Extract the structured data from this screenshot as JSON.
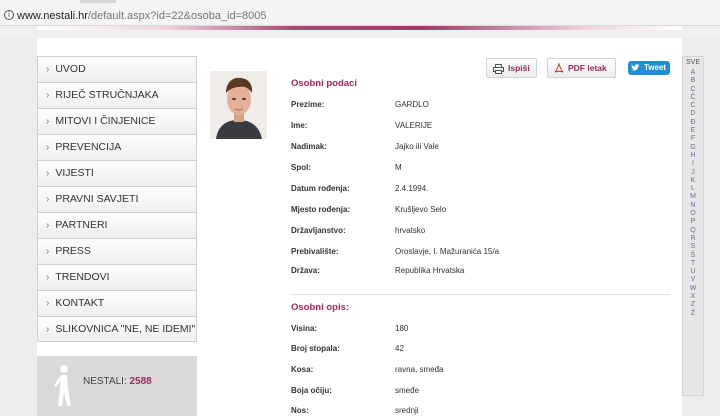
{
  "browser": {
    "url_host": "www.nestali.hr",
    "url_path": "/default.aspx?id=22&osoba_id=8005"
  },
  "menu": [
    {
      "label": "UVOD"
    },
    {
      "label": "RIJEČ STRUČNJAKA"
    },
    {
      "label": "MITOVI I ČINJENICE"
    },
    {
      "label": "PREVENCIJA"
    },
    {
      "label": "VIJESTI"
    },
    {
      "label": "PRAVNI SAVJETI"
    },
    {
      "label": "PARTNERI"
    },
    {
      "label": "PRESS"
    },
    {
      "label": "TRENDOVI"
    },
    {
      "label": "KONTAKT"
    },
    {
      "label": "SLIKOVNICA \"NE, NE IDEMI\""
    }
  ],
  "counter": {
    "label": "NESTALI:",
    "value": "2588"
  },
  "actions": {
    "print": "Ispiši",
    "pdf": "PDF letak",
    "tweet": "Tweet"
  },
  "personal": {
    "title": "Osobni podaci",
    "rows": [
      {
        "label": "Prezime:",
        "value": "GARDLO"
      },
      {
        "label": "Ime:",
        "value": "VALERIJE"
      },
      {
        "label": "Nadimak:",
        "value": "Jajko ili Vale"
      },
      {
        "label": "Spol:",
        "value": "M"
      },
      {
        "label": "Datum rođenja:",
        "value": "2.4.1994."
      },
      {
        "label": "Mjesto rođenja:",
        "value": "Krušljevo Selo"
      },
      {
        "label": "Državljanstvo:",
        "value": "hrvatsko"
      },
      {
        "label": "Prebivalište:",
        "value": "Oroslavje, I. Mažuranića 15/a"
      },
      {
        "label": "Država:",
        "value": "Republika Hrvatska"
      }
    ]
  },
  "description": {
    "title": "Osobni opis:",
    "rows": [
      {
        "label": "Visina:",
        "value": "180"
      },
      {
        "label": "Broj stopala:",
        "value": "42"
      },
      {
        "label": "Kosa:",
        "value": "ravna, smeđa"
      },
      {
        "label": "Boja očiju:",
        "value": "smeđe"
      },
      {
        "label": "Nos:",
        "value": "srednji"
      }
    ]
  },
  "alphabet": {
    "all": "SVE",
    "letters": [
      "A",
      "B",
      "C",
      "Č",
      "Ć",
      "D",
      "Đ",
      "E",
      "F",
      "G",
      "H",
      "I",
      "J",
      "K",
      "L",
      "M",
      "N",
      "O",
      "P",
      "Q",
      "R",
      "S",
      "Š",
      "T",
      "U",
      "V",
      "W",
      "X",
      "Z",
      "Ž"
    ]
  },
  "colors": {
    "accent": "#9a2a62",
    "tweet": "#1d8fd6"
  }
}
